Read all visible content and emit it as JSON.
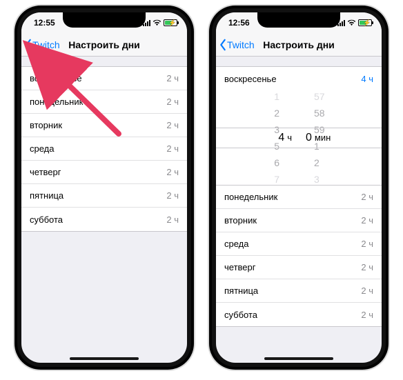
{
  "phones": {
    "left": {
      "time": "12:55",
      "back_label": "Twitch",
      "title": "Настроить дни",
      "days": [
        {
          "name": "воскресенье",
          "value": "2 ч",
          "active": false
        },
        {
          "name": "понедельник",
          "value": "2 ч",
          "active": false
        },
        {
          "name": "вторник",
          "value": "2 ч",
          "active": false
        },
        {
          "name": "среда",
          "value": "2 ч",
          "active": false
        },
        {
          "name": "четверг",
          "value": "2 ч",
          "active": false
        },
        {
          "name": "пятница",
          "value": "2 ч",
          "active": false
        },
        {
          "name": "суббота",
          "value": "2 ч",
          "active": false
        }
      ]
    },
    "right": {
      "time": "12:56",
      "back_label": "Twitch",
      "title": "Настроить дни",
      "top_row": {
        "name": "воскресенье",
        "value": "4 ч",
        "active": true
      },
      "picker": {
        "hours_above": [
          "1",
          "2",
          "3"
        ],
        "hours_below": [
          "5",
          "6",
          "7"
        ],
        "mins_above": [
          "57",
          "58",
          "59"
        ],
        "mins_below": [
          "1",
          "2",
          "3"
        ],
        "sel_hour": "4",
        "sel_hour_unit": "ч",
        "sel_min": "0",
        "sel_min_unit": "мин"
      },
      "days": [
        {
          "name": "понедельник",
          "value": "2 ч"
        },
        {
          "name": "вторник",
          "value": "2 ч"
        },
        {
          "name": "среда",
          "value": "2 ч"
        },
        {
          "name": "четверг",
          "value": "2 ч"
        },
        {
          "name": "пятница",
          "value": "2 ч"
        },
        {
          "name": "суббота",
          "value": "2 ч"
        }
      ]
    }
  }
}
